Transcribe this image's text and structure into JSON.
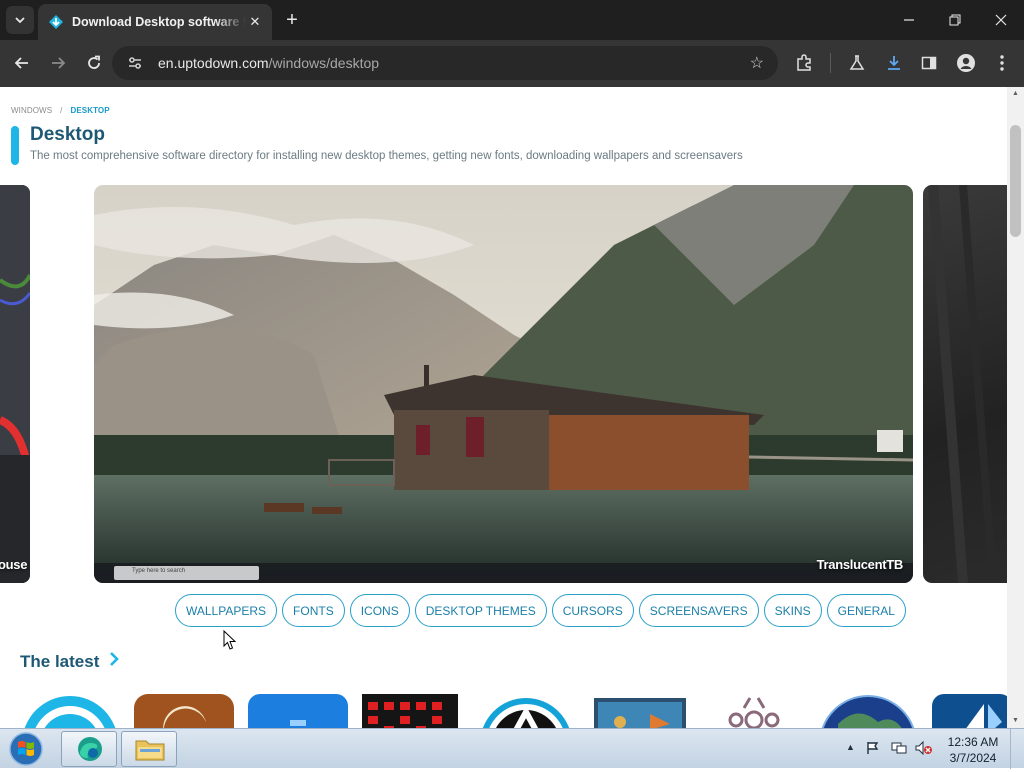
{
  "browser": {
    "tab": {
      "title": "Download Desktop software for Windows"
    },
    "url": {
      "host": "en.uptodown.com",
      "path": "/windows/desktop"
    }
  },
  "page": {
    "breadcrumb": {
      "root": "WINDOWS",
      "separator": "/",
      "current": "DESKTOP"
    },
    "title": "Desktop",
    "subtitle": "The most comprehensive software directory for installing new desktop themes, getting new fonts, downloading wallpapers and screensavers",
    "carousel": [
      {
        "label": "ouse Jiggler"
      },
      {
        "label": "TranslucentTB",
        "search_placeholder": "Type here to search"
      },
      {
        "label": ""
      }
    ],
    "categories": [
      "WALLPAPERS",
      "FONTS",
      "ICONS",
      "DESKTOP THEMES",
      "CURSORS",
      "SCREENSAVERS",
      "SKINS",
      "GENERAL"
    ],
    "latest": {
      "title": "The latest",
      "apps": [
        "app-1",
        "app-2",
        "app-3",
        "app-4",
        "app-5",
        "app-6",
        "app-7",
        "app-8",
        "app-9"
      ]
    },
    "accent_color": "#1eb6e6",
    "title_color": "#1e5874"
  },
  "taskbar": {
    "time": "12:36 AM",
    "date": "3/7/2024"
  }
}
